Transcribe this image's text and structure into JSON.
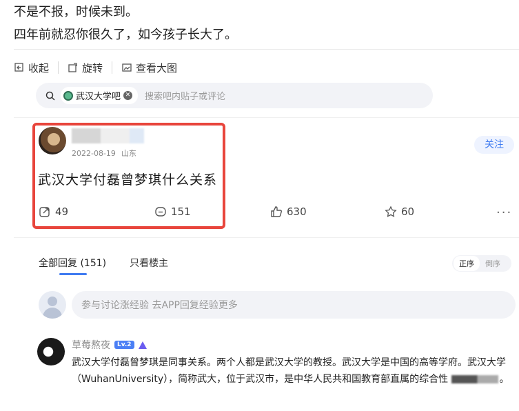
{
  "caption": {
    "line1": "不是不报，时候未到。",
    "line2": "四年前就忍你很久了，如今孩子长大了。"
  },
  "toolbar": {
    "collapse_label": "收起",
    "rotate_label": "旋转",
    "view_large_label": "查看大图"
  },
  "search": {
    "forum_name": "武汉大学吧",
    "placeholder": "搜索吧内贴子或评论"
  },
  "post": {
    "date": "2022-08-19",
    "location": "山东",
    "follow_label": "关注",
    "title": "武汉大学付磊曾梦琪什么关系",
    "stats": {
      "share": "49",
      "comments": "151",
      "likes": "630",
      "favorites": "60"
    }
  },
  "replies": {
    "tab_all": "全部回复 (151)",
    "tab_author": "只看楼主",
    "order_asc": "正序",
    "order_desc": "倒序",
    "input_placeholder": "参与讨论涨经验 去APP回复经验更多"
  },
  "comment": {
    "username": "草莓熬夜",
    "level": "Lv.2",
    "text": "武汉大学付磊曾梦琪是同事关系。两个人都是武汉大学的教授。武汉大学是中国的高等学府。武汉大学（WuhanUniversity），简称武大，位于武汉市，是中华人民共和国教育部直属的综合性",
    "tail": "。"
  },
  "colors": {
    "highlight_box": "#e8453c",
    "accent": "#3f7bf1"
  }
}
